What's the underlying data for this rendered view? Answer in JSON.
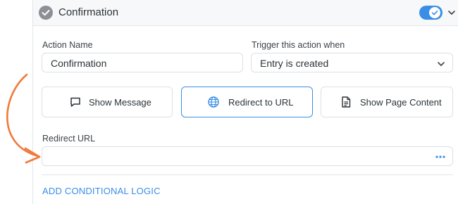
{
  "header": {
    "title": "Confirmation",
    "toggle_on": true
  },
  "form": {
    "action_name_label": "Action Name",
    "action_name_value": "Confirmation",
    "trigger_label": "Trigger this action when",
    "trigger_value": "Entry is created",
    "action_types": [
      {
        "label": "Show Message",
        "icon": "message-icon",
        "selected": false
      },
      {
        "label": "Redirect to URL",
        "icon": "globe-icon",
        "selected": true
      },
      {
        "label": "Show Page Content",
        "icon": "document-icon",
        "selected": false
      }
    ],
    "redirect_label": "Redirect URL",
    "redirect_value": "",
    "conditional_logic_link": "ADD CONDITIONAL LOGIC"
  },
  "colors": {
    "accent": "#3a8ee6",
    "arrow": "#f07a3a",
    "header_bg": "#f7f8f9",
    "border": "#dcdfe3"
  }
}
